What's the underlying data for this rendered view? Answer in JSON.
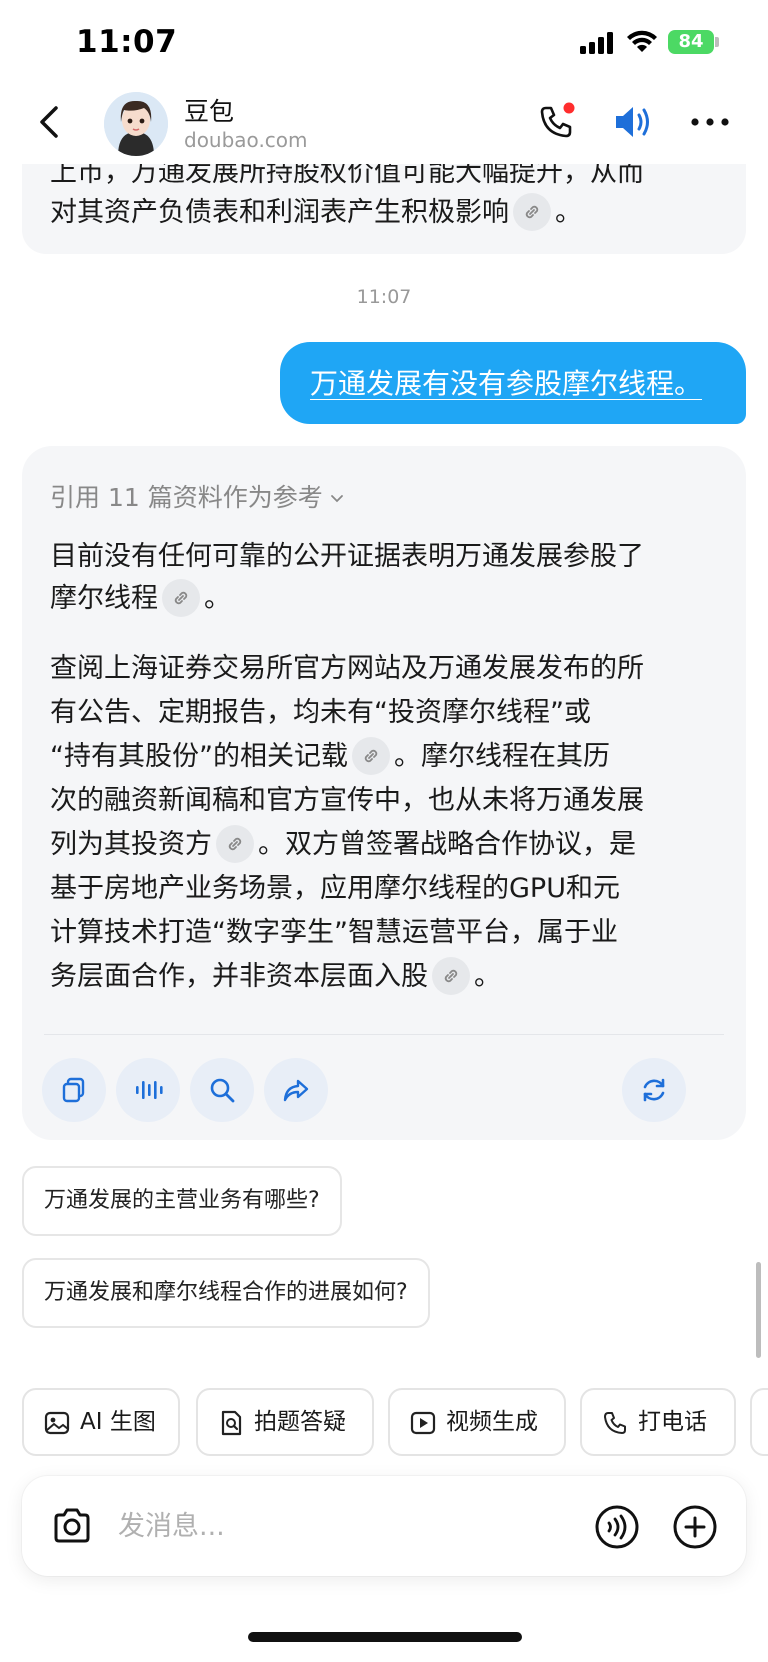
{
  "status_bar": {
    "time": "11:07",
    "battery": "84"
  },
  "header": {
    "bot_name": "豆包",
    "bot_domain": "doubao.com"
  },
  "previous_message": {
    "lines": [
      "上市，万通发展所持股权价值可能大幅提升，从而",
      "对其资产负债表和利润表产生积极影响"
    ],
    "end_punct": "。"
  },
  "timestamp": "11:07",
  "user_message": "万通发展有没有参股摩尔线程。",
  "assistant": {
    "reference_label": "引用 11 篇资料作为参考",
    "para1": [
      "目前没有任何可靠的公开证据表明万通发展参股了",
      "摩尔线程"
    ],
    "para2": [
      "查阅上海证券交易所官方网站及万通发展发布的所",
      "有公告、定期报告，均未有“投资摩尔线程”或",
      "“持有其股份”的相关记载",
      "。摩尔线程在其历",
      "次的融资新闻稿和官方宣传中，也从未将万通发展",
      "列为其投资方",
      "。双方曾签署战略合作协议，是",
      "基于房地产业务场景，应用摩尔线程的GPU和元",
      "计算技术打造“数字孪生”智慧运营平台，属于业",
      "务层面合作，并非资本层面入股"
    ],
    "period": "。"
  },
  "suggestions": [
    "万通发展的主营业务有哪些?",
    "万通发展和摩尔线程合作的进展如何?"
  ],
  "tools": [
    {
      "label": "AI 生图",
      "icon": "image-icon"
    },
    {
      "label": "拍题答疑",
      "icon": "scan-question-icon"
    },
    {
      "label": "视频生成",
      "icon": "video-icon"
    },
    {
      "label": "打电话",
      "icon": "phone-icon"
    }
  ],
  "input": {
    "placeholder": "发消息..."
  },
  "colors": {
    "accent": "#1fa6f5",
    "bubble_bg": "#f5f6f8",
    "battery": "#4cd964",
    "icon_blue": "#1e6fd9"
  }
}
